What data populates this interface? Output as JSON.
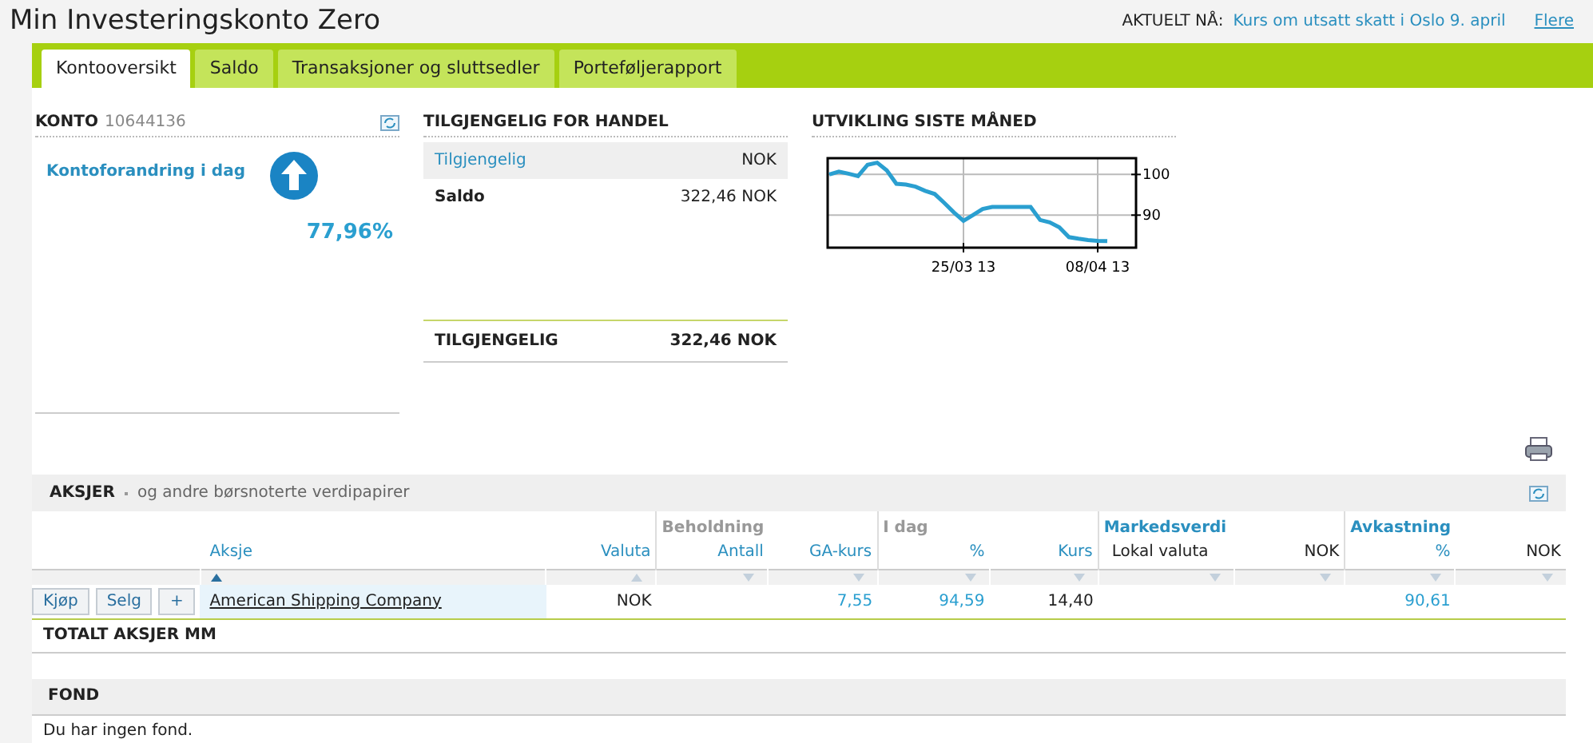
{
  "page_title": "Min Investeringskonto Zero",
  "news": {
    "label": "AKTUELT NÅ:",
    "headline": "Kurs om utsatt skatt i Oslo 9. april",
    "more": "Flere"
  },
  "tabs": [
    {
      "label": "Kontooversikt",
      "selected": true
    },
    {
      "label": "Saldo",
      "selected": false
    },
    {
      "label": "Transaksjoner og sluttsedler",
      "selected": false
    },
    {
      "label": "Porteføljerapport",
      "selected": false
    }
  ],
  "account": {
    "label": "KONTO",
    "number": "10644136",
    "change_label": "Kontoforandring i dag",
    "change_value": "77,96%"
  },
  "available": {
    "title": "TILGJENGELIG FOR HANDEL",
    "rows": [
      {
        "label": "Tilgjengelig",
        "value": "NOK",
        "kind": "header"
      },
      {
        "label": "Saldo",
        "value": "322,46 NOK",
        "kind": "bold"
      }
    ],
    "total_label": "TILGJENGELIG",
    "total_value": "322,46 NOK"
  },
  "development": {
    "title": "UTVIKLING SISTE MÅNED",
    "chart_data": {
      "type": "line",
      "categories": [
        null,
        null,
        null,
        null,
        null,
        null,
        null,
        null,
        null,
        null,
        null,
        null,
        null,
        null,
        "25/03 13",
        null,
        null,
        null,
        null,
        null,
        null,
        null,
        null,
        null,
        null,
        null,
        null,
        null,
        "08/04 13",
        null
      ],
      "series": [
        {
          "color": "#2a9fd0",
          "values": [
            100,
            100.7,
            100.2,
            99.6,
            102.4,
            102.9,
            101,
            97.7,
            97.5,
            97,
            96,
            95.2,
            93,
            90.7,
            88.6,
            90,
            91.5,
            92,
            92,
            92,
            92,
            92,
            88.8,
            88.2,
            87,
            84.6,
            84.2,
            83.9,
            83.7,
            83.6
          ]
        }
      ],
      "ylim": [
        82,
        104
      ],
      "grid": true,
      "yticks": [
        90,
        100
      ]
    }
  },
  "stocks": {
    "title": "AKSJER",
    "subtitle": "og andre børsnoterte verdipapirer",
    "groups": [
      {
        "label": "Beholdning",
        "kind": "grey"
      },
      {
        "label": "I dag",
        "kind": "grey"
      },
      {
        "label": "Markedsverdi",
        "kind": "blue"
      },
      {
        "label": "Avkastning",
        "kind": "blue"
      }
    ],
    "columns": [
      {
        "label": "Aksje",
        "kind": "link",
        "sorted": true,
        "ascending": true
      },
      {
        "label": "Valuta",
        "kind": "link",
        "sorted": false,
        "ascending": true
      },
      {
        "label": "Antall",
        "kind": "link",
        "sorted": false,
        "ascending": false
      },
      {
        "label": "GA-kurs",
        "kind": "link",
        "sorted": false,
        "ascending": false
      },
      {
        "label": "%",
        "kind": "link",
        "sorted": false,
        "ascending": false
      },
      {
        "label": "Kurs",
        "kind": "link",
        "sorted": false,
        "ascending": false
      },
      {
        "label": "Lokal valuta",
        "kind": "text",
        "sorted": false,
        "ascending": false
      },
      {
        "label": "NOK",
        "kind": "text",
        "sorted": false,
        "ascending": false
      },
      {
        "label": "%",
        "kind": "link",
        "sorted": false,
        "ascending": false
      },
      {
        "label": "NOK",
        "kind": "text",
        "sorted": false,
        "ascending": false
      }
    ],
    "rows": [
      {
        "buttons": [
          "Kjøp",
          "Selg",
          "+"
        ],
        "cells": [
          "American Shipping Company",
          "NOK",
          "",
          "7,55",
          "94,59",
          "14,40",
          "",
          "",
          "90,61",
          ""
        ]
      }
    ],
    "total_label": "TOTALT AKSJER MM"
  },
  "funds": {
    "title": "FOND",
    "empty": "Du har ingen fond."
  }
}
